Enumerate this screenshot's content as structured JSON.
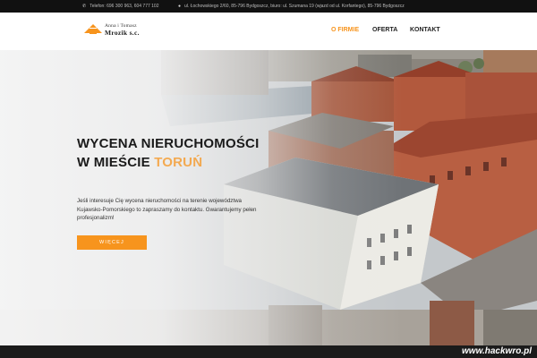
{
  "topbar": {
    "phone": "Telefon: 696 300 963, 604 777 102",
    "address": "ul. Łochowskiego 2/60, 85-796 Bydgoszcz, biuro: ul. Szumana 19 (wjazd od ul. Korfantego), 85-796 Bydgoszcz"
  },
  "logo": {
    "line1": "Anna i Tomasz",
    "line2": "Mrozik s.c."
  },
  "nav": {
    "items": [
      {
        "label": "O FIRMIE"
      },
      {
        "label": "OFERTA"
      },
      {
        "label": "KONTAKT"
      }
    ],
    "active": "O FIRMIE"
  },
  "hero": {
    "title_line1": "WYCENA NIERUCHOMOŚCI",
    "title_line2": "W MIEŚCIE",
    "title_logo": "TORUŃ",
    "description": "Jeśli interesuje Cię wycena nieruchomości na terenie województwa Kujawsko-Pomorskiego to zapraszamy do kontaktu. Gwarantujemy pełen profesjonalizm!",
    "cta_label": "WIĘCEJ"
  },
  "watermark": {
    "text": "www.hackwro.pl"
  },
  "colors": {
    "accent": "#f7941d",
    "topbar": "#111111",
    "text_dark": "#1a1a1a"
  }
}
